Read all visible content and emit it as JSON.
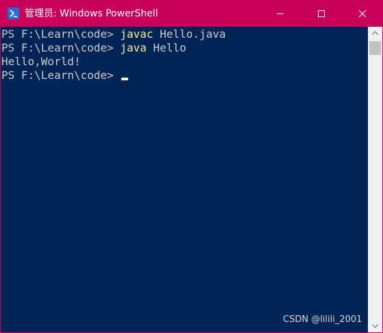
{
  "window": {
    "title": "管理员: Windows PowerShell",
    "app_icon": "powershell-icon",
    "controls": {
      "minimize": "minimize-icon",
      "maximize": "maximize-icon",
      "close": "close-icon"
    }
  },
  "console": {
    "lines": [
      {
        "prompt": "PS F:\\Learn\\code> ",
        "command": "javac",
        "args": " Hello.java"
      },
      {
        "prompt": "PS F:\\Learn\\code> ",
        "command": "java",
        "args": " Hello"
      },
      {
        "output": "Hello,World!"
      },
      {
        "prompt": "PS F:\\Learn\\code> "
      }
    ]
  },
  "colors": {
    "titlebar": "#c8005a",
    "background": "#012456",
    "text": "#cccccc",
    "command": "#f6f192",
    "cursor": "#fff4b5"
  },
  "watermark": "CSDN @lilili_2001"
}
